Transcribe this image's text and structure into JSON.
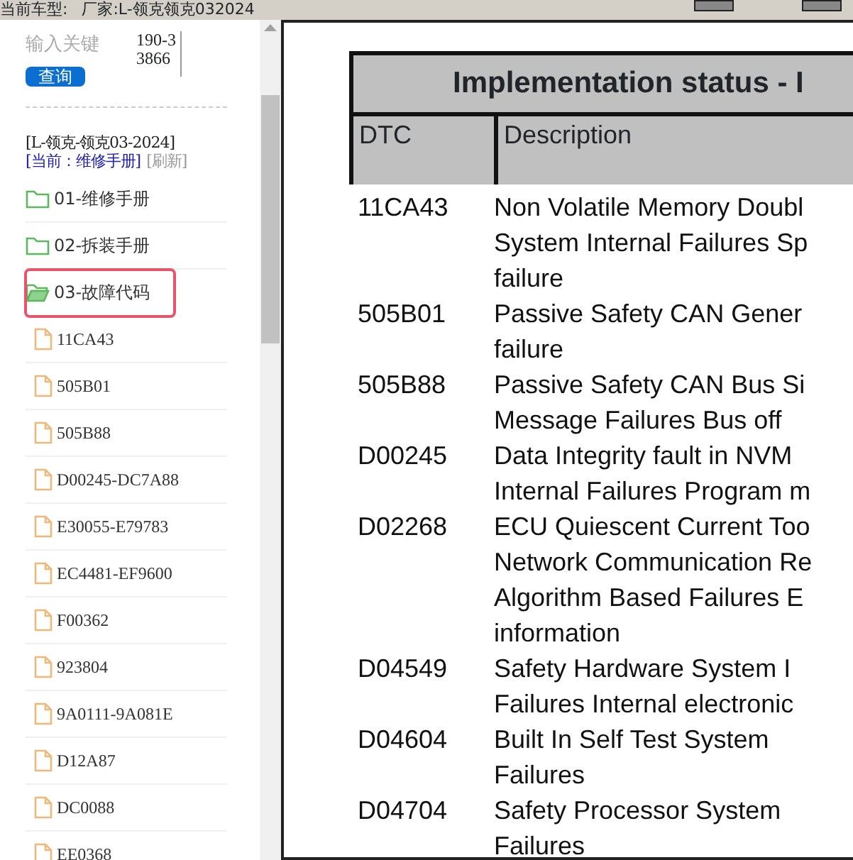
{
  "top_bar": {
    "label": "当前车型:",
    "maker": "厂家:L-领克领克032024"
  },
  "sidebar": {
    "search": {
      "placeholder": "输入关键",
      "button": "查询",
      "note": "190-33866"
    },
    "vehicle": "[L-领克-领克03-2024]",
    "current": "[当前：维修手册]",
    "refresh": "[刷新]",
    "tree": [
      {
        "label": "01-维修手册",
        "kind": "folder",
        "expanded": false,
        "selected": false
      },
      {
        "label": "02-拆装手册",
        "kind": "folder",
        "expanded": false,
        "selected": false
      },
      {
        "label": "03-故障代码",
        "kind": "folder",
        "expanded": true,
        "selected": true,
        "children": [
          {
            "label": "11CA43",
            "kind": "file",
            "selected": false
          },
          {
            "label": "505B01",
            "kind": "file",
            "selected": false
          },
          {
            "label": "505B88",
            "kind": "file",
            "selected": false
          },
          {
            "label": "D00245-DC7A88",
            "kind": "file",
            "selected": false
          },
          {
            "label": "E30055-E79783",
            "kind": "file",
            "selected": false
          },
          {
            "label": "EC4481-EF9600",
            "kind": "file",
            "selected": false
          },
          {
            "label": "F00362",
            "kind": "file",
            "selected": false
          },
          {
            "label": "923804",
            "kind": "file",
            "selected": false
          },
          {
            "label": "9A0111-9A081E",
            "kind": "file",
            "selected": false
          },
          {
            "label": "D12A87",
            "kind": "file",
            "selected": false
          },
          {
            "label": "DC0088",
            "kind": "file",
            "selected": false
          },
          {
            "label": "EE0368",
            "kind": "file",
            "selected": false
          }
        ]
      }
    ]
  },
  "document": {
    "title": "Implementation status - I",
    "columns": [
      "DTC",
      "Description"
    ],
    "rows": [
      {
        "dtc": "11CA43",
        "lines": [
          "Non Volatile Memory Doubl",
          "System Internal Failures Sp",
          "failure"
        ]
      },
      {
        "dtc": "505B01",
        "lines": [
          "Passive Safety CAN  Gener",
          "failure"
        ]
      },
      {
        "dtc": "505B88",
        "lines": [
          "Passive Safety CAN Bus Si",
          "Message Failures Bus off"
        ]
      },
      {
        "dtc": "D00245",
        "lines": [
          "Data Integrity fault in NVM",
          "Internal Failures Program m"
        ]
      },
      {
        "dtc": "D02268",
        "lines": [
          "ECU Quiescent Current Too",
          "Network Communication Re",
          "Algorithm Based Failures E",
          "information"
        ]
      },
      {
        "dtc": "D04549",
        "lines": [
          "Safety Hardware   System I",
          "Failures Internal electronic"
        ]
      },
      {
        "dtc": "D04604",
        "lines": [
          "Built In Self Test   System",
          "Failures"
        ]
      },
      {
        "dtc": "D04704",
        "lines": [
          "Safety Processor   System",
          "Failures"
        ]
      }
    ]
  }
}
